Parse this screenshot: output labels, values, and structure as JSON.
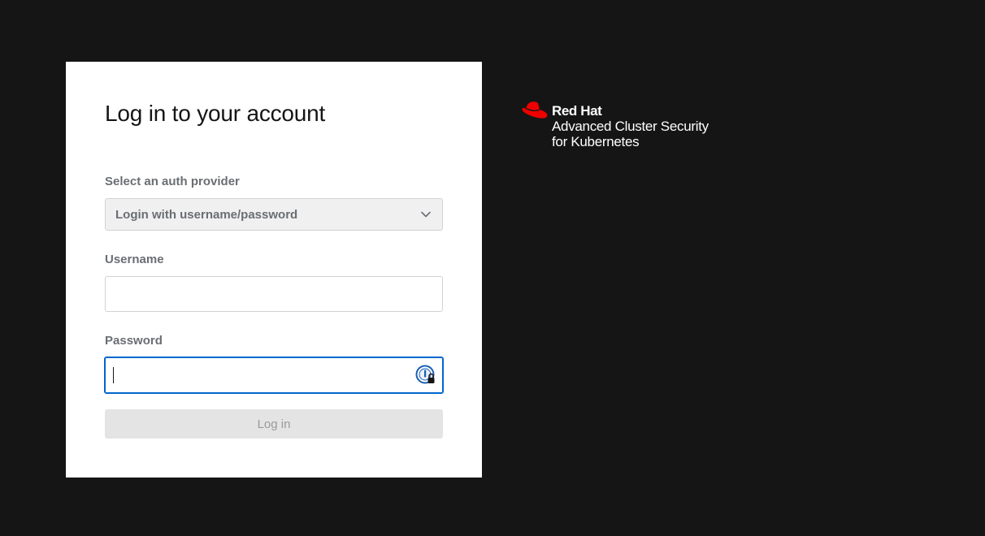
{
  "login_card": {
    "title": "Log in to your account",
    "auth_provider": {
      "label": "Select an auth provider",
      "selected": "Login with username/password"
    },
    "username": {
      "label": "Username",
      "value": "",
      "placeholder": ""
    },
    "password": {
      "label": "Password",
      "value": "",
      "placeholder": ""
    },
    "login_button": "Log in"
  },
  "brand": {
    "company": "Red Hat",
    "product": "Advanced Cluster Security",
    "subtitle": "for Kubernetes",
    "logo_icon": "red-hat-fedora-icon"
  },
  "colors": {
    "background": "#151515",
    "card": "#ffffff",
    "focus_border": "#0066cc",
    "brand_red": "#ee0000",
    "button_disabled_bg": "#e4e4e4",
    "button_disabled_text": "#9a9a9a"
  }
}
